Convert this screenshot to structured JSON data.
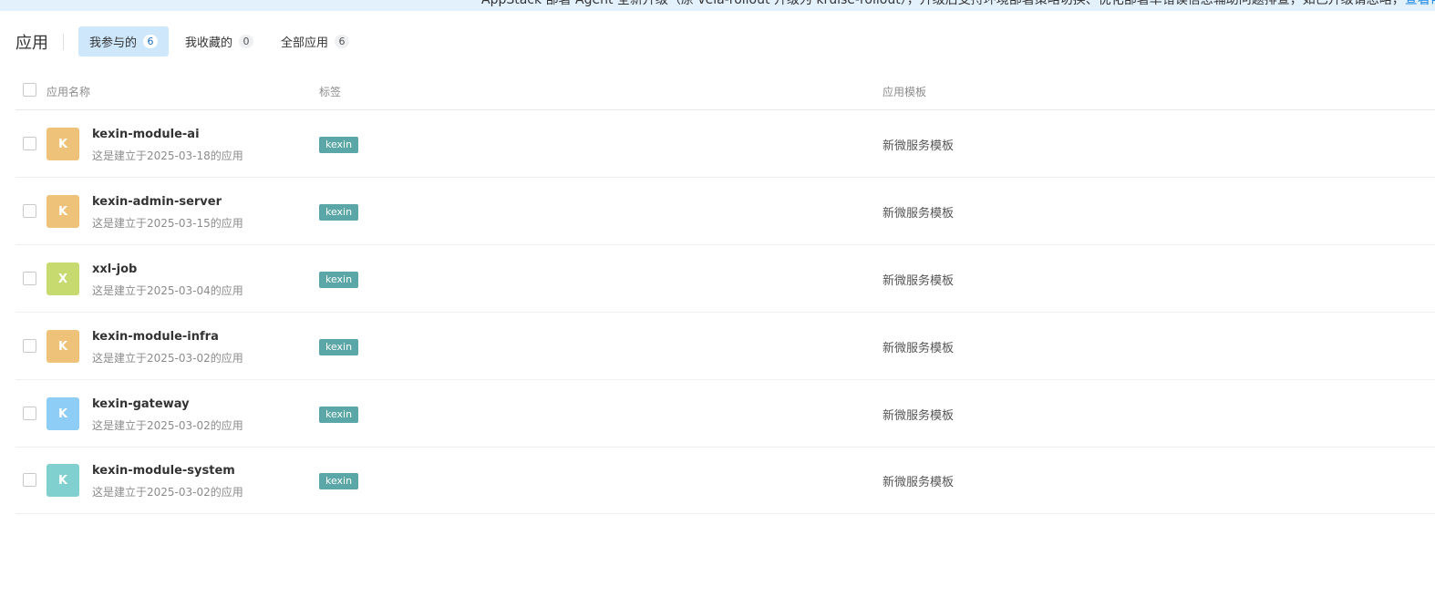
{
  "banner": {
    "text": "AppStack 部署 Agent 全新升级（原 vela-rollout 升级为 kruise-rollout），升级后支持环境部署策略切换、优化部署单错误信息辅助问题排查，如已升级请忽略，",
    "link": "查看帮助"
  },
  "header": {
    "title": "应用",
    "tabs": [
      {
        "label": "我参与的",
        "count": "6"
      },
      {
        "label": "我收藏的",
        "count": "0"
      },
      {
        "label": "全部应用",
        "count": "6"
      }
    ]
  },
  "table": {
    "columns": {
      "name": "应用名称",
      "tags": "标签",
      "template": "应用模板"
    },
    "rows": [
      {
        "initial": "K",
        "avatar_color": "#efc27a",
        "name": "kexin-module-ai",
        "desc": "这是建立于2025-03-18的应用",
        "tag": "kexin",
        "template": "新微服务模板"
      },
      {
        "initial": "K",
        "avatar_color": "#efc27a",
        "name": "kexin-admin-server",
        "desc": "这是建立于2025-03-15的应用",
        "tag": "kexin",
        "template": "新微服务模板"
      },
      {
        "initial": "X",
        "avatar_color": "#c7da6f",
        "name": "xxl-job",
        "desc": "这是建立于2025-03-04的应用",
        "tag": "kexin",
        "template": "新微服务模板"
      },
      {
        "initial": "K",
        "avatar_color": "#efc27a",
        "name": "kexin-module-infra",
        "desc": "这是建立于2025-03-02的应用",
        "tag": "kexin",
        "template": "新微服务模板"
      },
      {
        "initial": "K",
        "avatar_color": "#8ecdf5",
        "name": "kexin-gateway",
        "desc": "这是建立于2025-03-02的应用",
        "tag": "kexin",
        "template": "新微服务模板"
      },
      {
        "initial": "K",
        "avatar_color": "#7fd0cf",
        "name": "kexin-module-system",
        "desc": "这是建立于2025-03-02的应用",
        "tag": "kexin",
        "template": "新微服务模板"
      }
    ]
  }
}
